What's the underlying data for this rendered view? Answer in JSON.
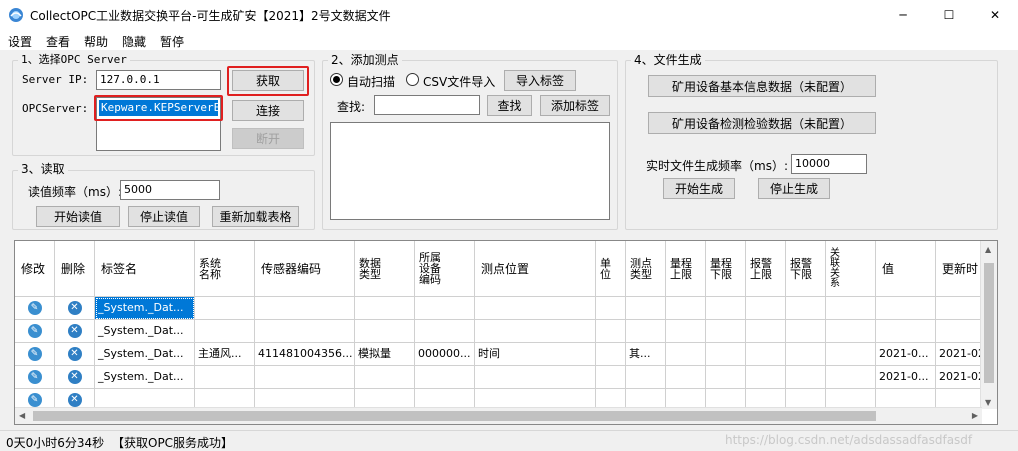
{
  "window": {
    "title": "CollectOPC工业数据交换平台-可生成矿安【2021】2号文数据文件",
    "min_glyph": "─",
    "max_glyph": "☐",
    "close_glyph": "✕"
  },
  "menu": [
    "设置",
    "查看",
    "帮助",
    "隐藏",
    "暂停"
  ],
  "opc_server": {
    "title": "1、选择OPC Server",
    "server_ip_label": "Server IP:",
    "server_ip_value": "127.0.0.1",
    "opcserver_label": "OPCServer:",
    "opcserver_value": "Kepware.KEPServerEX",
    "fetch_button": "获取",
    "connect_button": "连接",
    "disconnect_button": "断开"
  },
  "read": {
    "title": "3、读取",
    "freq_label": "读值频率（ms）:",
    "freq_value": "5000",
    "start_button": "开始读值",
    "stop_button": "停止读值",
    "reload_button": "重新加载表格"
  },
  "add_points": {
    "title": "2、添加测点",
    "auto_scan_label": "自动扫描",
    "csv_import_label": "CSV文件导入",
    "import_tag_button": "导入标签",
    "search_label": "查找:",
    "search_value": "",
    "search_button": "查找",
    "add_tag_button": "添加标签"
  },
  "file_gen": {
    "title": "4、文件生成",
    "basic_info_button": "矿用设备基本信息数据（未配置）",
    "inspection_button": "矿用设备检测检验数据（未配置）",
    "realtime_freq_label": "实时文件生成频率（ms）:",
    "realtime_freq_value": "10000",
    "start_gen_button": "开始生成",
    "stop_gen_button": "停止生成"
  },
  "grid": {
    "headers": {
      "edit": "修改",
      "delete": "删除",
      "tag_name": "标签名",
      "system_name": "系统\n名称",
      "sensor_code": "传感器编码",
      "data_type": "数据\n类型",
      "owning_device": "所属\n设备\n编码",
      "point_location": "测点位置",
      "unit": "单\n位",
      "point_type": "测点\n类型",
      "range_upper": "量程\n上限",
      "range_lower": "量程\n下限",
      "alarm_upper": "报警\n上限",
      "alarm_lower": "报警\n下限",
      "relation": "关\n联\n关\n系",
      "value": "值",
      "update_time": "更新时"
    },
    "rows": [
      {
        "tag": "_System._Dat...",
        "system": "",
        "sensor": "",
        "dtype": "",
        "device": "",
        "location": "",
        "unit": "",
        "ptype": "",
        "value": "",
        "time": ""
      },
      {
        "tag": "_System._Dat...",
        "system": "",
        "sensor": "",
        "dtype": "",
        "device": "",
        "location": "",
        "unit": "",
        "ptype": "",
        "value": "",
        "time": ""
      },
      {
        "tag": "_System._Dat...",
        "system": "主通风...",
        "sensor": "411481004356...",
        "dtype": "模拟量",
        "device": "000000...",
        "location": "时间",
        "unit": "",
        "ptype": "其...",
        "value": "2021-0...",
        "time": "2021-02"
      },
      {
        "tag": "_System._Dat...",
        "system": "",
        "sensor": "",
        "dtype": "",
        "device": "",
        "location": "",
        "unit": "",
        "ptype": "",
        "value": "2021-0...",
        "time": "2021-02"
      },
      {
        "tag": "",
        "system": "",
        "sensor": "",
        "dtype": "",
        "device": "",
        "location": "",
        "unit": "",
        "ptype": "",
        "value": "",
        "time": ""
      }
    ]
  },
  "status": {
    "uptime": "0天0小时6分34秒",
    "message": "【获取OPC服务成功】"
  },
  "watermark": "https://blog.csdn.net/adsdassadfasdfasdf",
  "colors": {
    "selection": "#0078d7",
    "highlight": "#e02020",
    "icon_blue": "#3a8fd0"
  }
}
